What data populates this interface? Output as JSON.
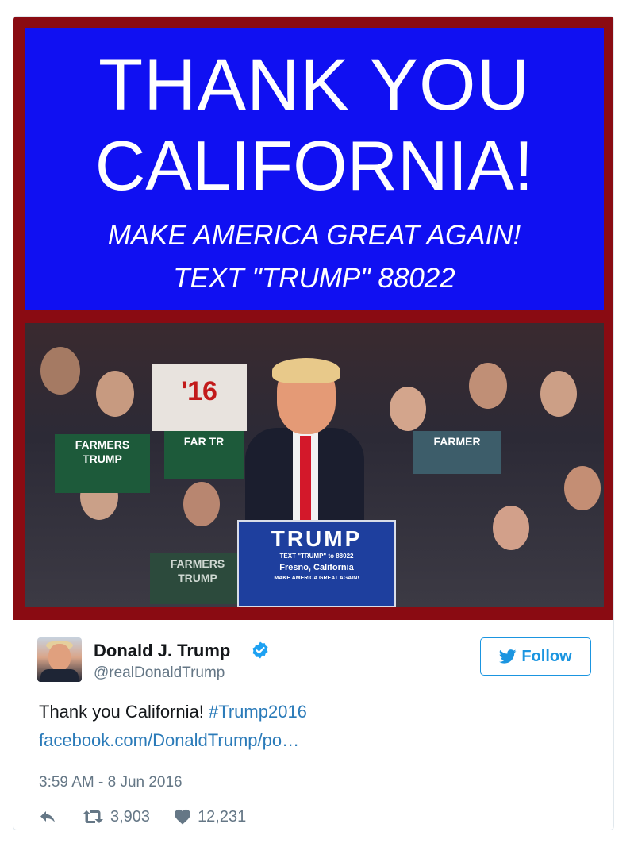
{
  "media": {
    "banner": {
      "line1": "THANK YOU",
      "line2": "CALIFORNIA!",
      "line3": "MAKE AMERICA GREAT AGAIN!",
      "line4": "TEXT \"TRUMP\" 88022"
    },
    "photo": {
      "podium_title": "TRUMP",
      "podium_text": "TEXT \"TRUMP\" to 88022",
      "podium_location": "Fresno, California",
      "podium_slogan": "MAKE AMERICA GREAT AGAIN!",
      "sign_left": "FARMERS TRUMP",
      "sign_center": "FAR TR",
      "sign_bottom": "FARMERS TRUMP",
      "sign_right": "FARMER",
      "sign_back": "'16"
    },
    "colors": {
      "banner_bg": "#1010f2",
      "frame_red": "#8a0b12"
    }
  },
  "author": {
    "name": "Donald J. Trump",
    "handle": "@realDonaldTrump",
    "verified_icon": "verified-badge-icon"
  },
  "follow": {
    "label": "Follow",
    "icon": "twitter-bird-icon"
  },
  "tweet": {
    "text": "Thank you California! ",
    "hashtag": "#Trump2016",
    "link": "facebook.com/DonaldTrump/po…",
    "timestamp": "3:59 AM - 8 Jun 2016"
  },
  "actions": {
    "reply_icon": "reply-icon",
    "retweet_icon": "retweet-icon",
    "retweet_count": "3,903",
    "like_icon": "heart-icon",
    "like_count": "12,231"
  },
  "colors": {
    "link": "#2b7bb9",
    "twitter_blue": "#1b95e0",
    "muted": "#657786"
  }
}
